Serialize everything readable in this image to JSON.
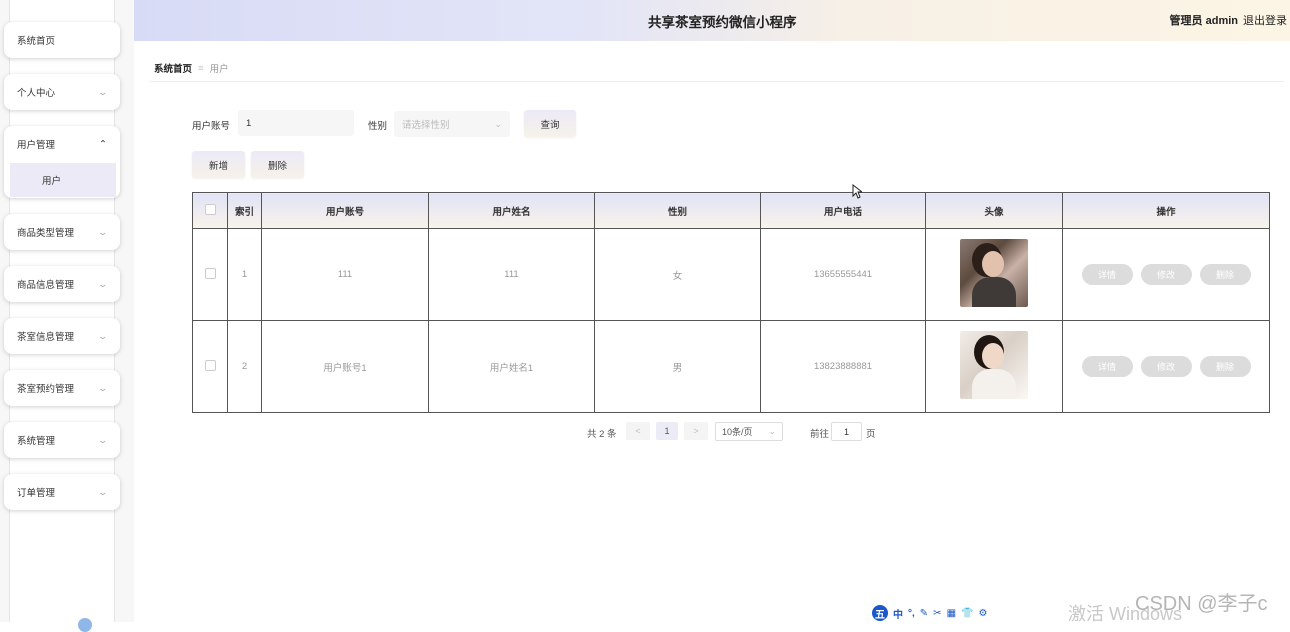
{
  "header": {
    "title": "共享茶室预约微信小程序",
    "user_label": "管理员 admin",
    "logout": "退出登录"
  },
  "sidebar": {
    "items": [
      {
        "label": "系统首页"
      },
      {
        "label": "个人中心"
      },
      {
        "label": "用户管理",
        "expanded": true,
        "children": [
          {
            "label": "用户"
          }
        ]
      },
      {
        "label": "商品类型管理"
      },
      {
        "label": "商品信息管理"
      },
      {
        "label": "茶室信息管理"
      },
      {
        "label": "茶室预约管理"
      },
      {
        "label": "系统管理"
      },
      {
        "label": "订单管理"
      }
    ]
  },
  "breadcrumb": {
    "home": "系统首页",
    "separator": "≡",
    "current": "用户"
  },
  "search": {
    "account_label": "用户账号",
    "account_value": "1",
    "gender_label": "性别",
    "gender_placeholder": "请选择性别",
    "query_button": "查询"
  },
  "actions": {
    "add": "新增",
    "delete": "删除"
  },
  "table": {
    "columns": [
      "索引",
      "用户账号",
      "用户姓名",
      "性别",
      "用户电话",
      "头像",
      "操作"
    ],
    "rows": [
      {
        "index": "1",
        "account": "111",
        "name": "111",
        "gender": "女",
        "phone": "13655555441",
        "avatar": "avatar-photo-woman"
      },
      {
        "index": "2",
        "account": "用户账号1",
        "name": "用户姓名1",
        "gender": "男",
        "phone": "13823888881",
        "avatar": "avatar-photo-woman"
      }
    ],
    "op_buttons": {
      "detail": "详情",
      "edit": "修改",
      "delete": "删除"
    }
  },
  "pagination": {
    "total": "共 2 条",
    "prev": "<",
    "current_page": "1",
    "next": ">",
    "page_size": "10条/页",
    "goto_label": "前往",
    "goto_value": "1",
    "page_unit": "页"
  },
  "overlays": {
    "ime_icons": [
      "中",
      "°,",
      "✎",
      "✂",
      "▦",
      "👕",
      "⚙"
    ],
    "ime_logo": "五",
    "windows_watermark": "激活 Windows",
    "csdn_watermark": "CSDN @李子c"
  },
  "colors": {
    "header_left": "#d8dbf6",
    "header_right": "#fcf4e4",
    "active_submenu": "#ebeaf6",
    "op_button": "#dcdcdc"
  }
}
